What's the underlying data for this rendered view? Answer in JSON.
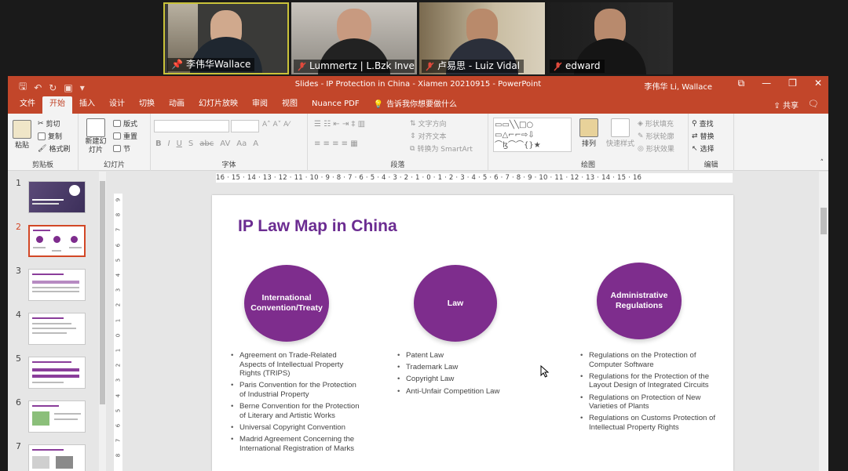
{
  "participants": [
    {
      "name": "李伟华Wallace",
      "muted": false,
      "pinned": true
    },
    {
      "name": "Lummertz | L.Bzk Inves...",
      "muted": true
    },
    {
      "name": "卢易思 - Luiz Vidal",
      "muted": true
    },
    {
      "name": "edward",
      "muted": true
    }
  ],
  "window": {
    "title": "Slides - IP Protection in China - Xiamen 20210915  -  PowerPoint",
    "user": "李伟华 Li, Wallace",
    "buttons": [
      "⧉",
      "—",
      "❐",
      "✕"
    ]
  },
  "ribbon": {
    "tabs": [
      "文件",
      "开始",
      "插入",
      "设计",
      "切换",
      "动画",
      "幻灯片放映",
      "审阅",
      "视图",
      "Nuance PDF"
    ],
    "active_tab": "开始",
    "tellme": "告诉我你想要做什么",
    "share": "共享",
    "groups": {
      "clipboard": {
        "label": "剪贴板",
        "paste": "粘贴",
        "cut": "剪切",
        "copy": "复制",
        "format_painter": "格式刷"
      },
      "slides": {
        "label": "幻灯片",
        "new_slide": "新建幻灯片",
        "layout": "版式",
        "reset": "重置",
        "section": "节"
      },
      "font": {
        "label": "字体",
        "bold": "B",
        "italic": "I",
        "underline": "U",
        "shadow": "S",
        "strike": "abc"
      },
      "paragraph": {
        "label": "段落",
        "text_direction": "文字方向",
        "align_text": "对齐文本",
        "smartart": "转换为 SmartArt"
      },
      "drawing": {
        "label": "绘图",
        "arrange": "排列",
        "quick_styles": "快速样式",
        "shape_fill": "形状填充",
        "shape_outline": "形状轮廓",
        "shape_effects": "形状效果"
      },
      "editing": {
        "label": "编辑",
        "find": "查找",
        "replace": "替换",
        "select": "选择"
      }
    }
  },
  "ruler": {
    "horizontal": "16 · 15 · 14 · 13 · 12 · 11 · 10 · 9 · 8 · 7 · 6 · 5 · 4 · 3 · 2 · 1 · 0 · 1 · 2 · 3 · 4 · 5 · 6 · 7 · 8 · 9 · 10 · 11 · 12 · 13 · 14 · 15 · 16",
    "vertical": [
      "9",
      "8",
      "7",
      "6",
      "5",
      "4",
      "3",
      "2",
      "1",
      "0",
      "1",
      "2",
      "3",
      "4",
      "5",
      "6",
      "7",
      "8"
    ]
  },
  "thumbnails": [
    {
      "num": "1",
      "selected": false
    },
    {
      "num": "2",
      "selected": true
    },
    {
      "num": "3",
      "selected": false
    },
    {
      "num": "4",
      "selected": false
    },
    {
      "num": "5",
      "selected": false
    },
    {
      "num": "6",
      "selected": false
    },
    {
      "num": "7",
      "selected": false
    }
  ],
  "slide": {
    "title": "IP Law Map in China",
    "circles": [
      {
        "label": "International Convention/Treaty"
      },
      {
        "label": "Law"
      },
      {
        "label": "Administrative Regulations"
      }
    ],
    "columns": [
      {
        "items": [
          "Agreement on Trade-Related Aspects of Intellectual Property Rights (TRIPS)",
          "Paris Convention for the Protection of Industrial Property",
          "Berne Convention for the Protection of Literary and Artistic Works",
          "Universal Copyright Convention",
          "Madrid Agreement Concerning the International Registration of Marks"
        ]
      },
      {
        "items": [
          "Patent Law",
          "Trademark Law",
          "Copyright Law",
          "Anti-Unfair Competition Law"
        ]
      },
      {
        "items": [
          "Regulations on the Protection of Computer Software",
          "Regulations for the Protection of the Layout Design of Integrated Circuits",
          "Regulations on Protection of New Varieties of Plants",
          "Regulations on Customs Protection of Intellectual Property Rights"
        ]
      }
    ]
  },
  "colors": {
    "accent": "#c2462a",
    "slide_purple": "#7e2d8d",
    "title_purple": "#6b2c91"
  }
}
